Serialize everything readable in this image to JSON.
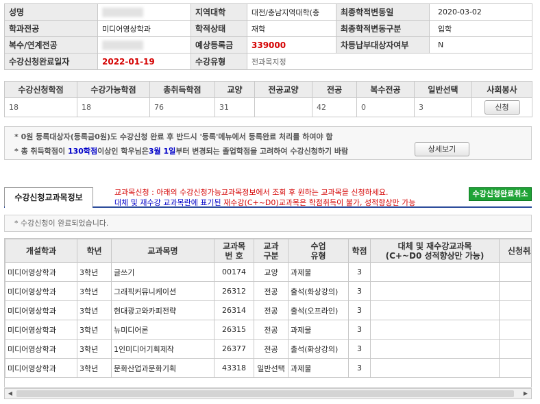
{
  "info": {
    "row1": {
      "name_label": "성명",
      "region_label": "지역대학",
      "region_value": "대전/충남지역대학(충",
      "last_change_date_label": "최종학적변동일",
      "last_change_date_value": "2020-03-02"
    },
    "row2": {
      "major_label": "학과전공",
      "major_value": "미디어영상학과",
      "status_label": "학적상태",
      "status_value": "재학",
      "last_change_type_label": "최종학적변동구분",
      "last_change_type_value": "입학"
    },
    "row3": {
      "double_major_label": "복수/연계전공",
      "expected_fee_label": "예상등록금",
      "expected_fee_value": "339000",
      "differential_label": "차등납부대상자여부",
      "differential_value": "N"
    },
    "row4": {
      "complete_date_label": "수강신청완료일자",
      "complete_date_value": "2022-01-19",
      "reg_type_label": "수강유형",
      "reg_type_value": "전과목지정"
    }
  },
  "credits": {
    "headers": [
      "수강신청학점",
      "수강가능학점",
      "총취득학점",
      "교양",
      "전공교양",
      "전공",
      "복수전공",
      "일반선택",
      "사회봉사"
    ],
    "values": [
      "18",
      "18",
      "76",
      "31",
      "",
      "42",
      "0",
      "3",
      ""
    ],
    "apply_button": "신청"
  },
  "notice": {
    "line1": "* 0원 등록대상자(등록금0원)도 수강신청 완료 후 반드시 '등록'메뉴에서 등록완료 처리를 하여야 함",
    "line2_a": "* 총 취득학점이 ",
    "line2_b": "130학점",
    "line2_c": "이상인 학우님은",
    "line2_d": "3월 1일",
    "line2_e": "부터 변경되는 졸업학점을 고려하여 수강신청하기 바람",
    "detail_button": "상세보기"
  },
  "tab": {
    "label": "수강신청교과목정보"
  },
  "instructions": {
    "line1_a": "교과목신청 : 아래의 수강신청가능교과목정보에서 조회 후 원하는 교과목을 신청하세요.",
    "line2_a": "대체 및 재수강 교과목란에 표기된 ",
    "line2_b": "재수강(C+~D0)교과목은 학점취득이 불가, 성적향상만 가능"
  },
  "done_button": "수강신청완료취소",
  "done_message": "* 수강신청이 완료되었습니다.",
  "course_table": {
    "headers": [
      "개설학과",
      "학년",
      "교과목명",
      "교과목\n번  호",
      "교과\n구분",
      "수업\n유형",
      "학점",
      "대체 및 재수강교과목\n(C+~D0 성적향상만 가능)",
      "신청취소"
    ],
    "rows": [
      {
        "dept": "미디어영상학과",
        "year": "3학년",
        "name": "글쓰기",
        "code": "00174",
        "category": "교양",
        "type": "과제물",
        "credit": "3"
      },
      {
        "dept": "미디어영상학과",
        "year": "3학년",
        "name": "그래픽커뮤니케이션",
        "code": "26312",
        "category": "전공",
        "type": "출석(화상강의)",
        "credit": "3"
      },
      {
        "dept": "미디어영상학과",
        "year": "3학년",
        "name": "현대광고와카피전략",
        "code": "26314",
        "category": "전공",
        "type": "출석(오프라인)",
        "credit": "3"
      },
      {
        "dept": "미디어영상학과",
        "year": "3학년",
        "name": "뉴미디어론",
        "code": "26315",
        "category": "전공",
        "type": "과제물",
        "credit": "3"
      },
      {
        "dept": "미디어영상학과",
        "year": "3학년",
        "name": "1인미디어기획제작",
        "code": "26377",
        "category": "전공",
        "type": "출석(화상강의)",
        "credit": "3"
      },
      {
        "dept": "미디어영상학과",
        "year": "3학년",
        "name": "문화산업과문화기획",
        "code": "43318",
        "category": "일반선택",
        "type": "과제물",
        "credit": "3"
      }
    ]
  },
  "icons": {
    "scroll_left": "arrow-left-icon",
    "scroll_right": "arrow-right-icon"
  }
}
